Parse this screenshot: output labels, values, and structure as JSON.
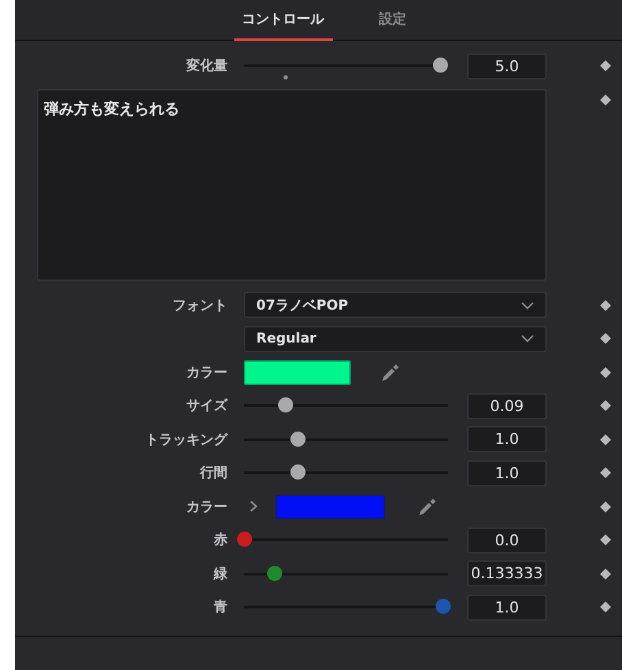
{
  "tabs": [
    {
      "label": "コントロール",
      "selected": true
    },
    {
      "label": "設定",
      "selected": false
    }
  ],
  "controls": [
    {
      "kind": "slider",
      "label": "変化量",
      "level": 0.96,
      "value": "5.0",
      "default_mark": {
        "level": 0.2
      }
    },
    {
      "kind": "text",
      "value": "弾み方も変えられる"
    },
    {
      "kind": "dropdown",
      "label": "フォント",
      "value": "07ラノベPOP"
    },
    {
      "kind": "dropdown",
      "value": "Regular"
    },
    {
      "kind": "color",
      "label": "カラー",
      "color": "#00f58c"
    },
    {
      "kind": "slider",
      "label": "サイズ",
      "level": 0.2,
      "value": "0.09"
    },
    {
      "kind": "slider",
      "label": "トラッキング",
      "level": 0.26,
      "value": "1.0"
    },
    {
      "kind": "slider",
      "label": "行間",
      "level": 0.26,
      "value": "1.0"
    },
    {
      "kind": "color",
      "label": "カラー",
      "color": "#0010f5",
      "expanded": false
    },
    {
      "kind": "slider",
      "label": "赤",
      "level": 0.0,
      "value": "0.0",
      "color": "#c81e1e"
    },
    {
      "kind": "slider",
      "label": "緑",
      "level": 0.15,
      "value": "0.133333",
      "color": "#1e8c2d"
    },
    {
      "kind": "slider",
      "label": "青",
      "level": 0.97,
      "value": "1.0",
      "color": "#1b55b0"
    }
  ]
}
